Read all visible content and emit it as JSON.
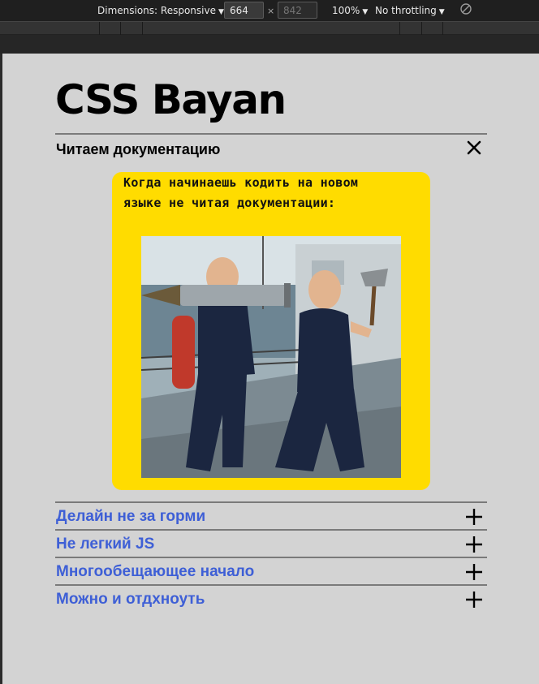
{
  "devtools": {
    "dimensions_label": "Dimensions: Responsive",
    "width_value": "664",
    "height_placeholder": "842",
    "times": "×",
    "zoom": "100%",
    "throttling": "No throttling",
    "caret": "▼"
  },
  "page": {
    "title": "CSS Bayan",
    "open_item": {
      "title": "Читаем документацию",
      "meme_caption": "Когда начинаешь кодить на новом языке не читая документации:"
    },
    "items": [
      {
        "label": "Делайн не за горми"
      },
      {
        "label": "Не легкий JS"
      },
      {
        "label": "Многообещающее начало"
      },
      {
        "label": "Можно и отдхноуть"
      }
    ]
  },
  "colors": {
    "meme_bg": "#ffdc00",
    "link": "#3e5fd6",
    "page_bg": "#d3d3d3"
  }
}
